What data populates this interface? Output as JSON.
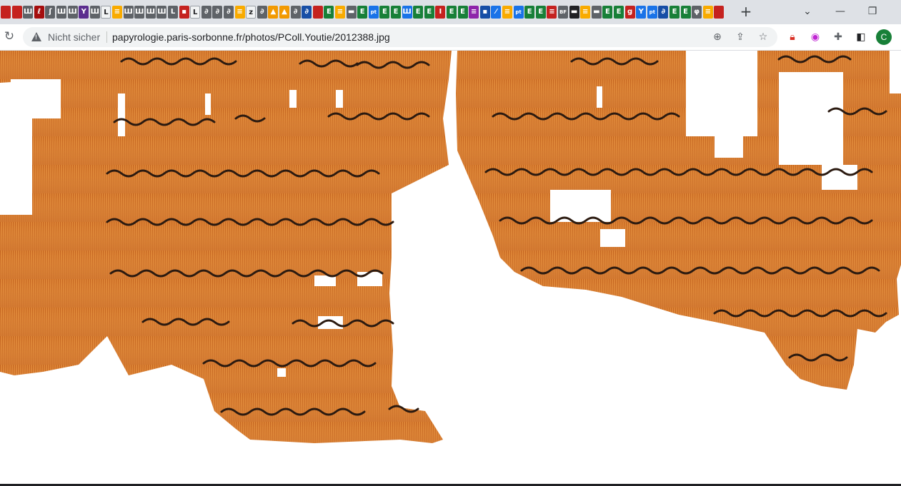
{
  "tabs": {
    "count_label": "",
    "items": [
      {
        "icon": "red-tab-icon",
        "color": "#c5221f",
        "glyph": ""
      },
      {
        "icon": "red-tab-icon",
        "color": "#c5221f",
        "glyph": ""
      },
      {
        "icon": "museum-tab-icon",
        "color": "#5f6368",
        "glyph": "Ш"
      },
      {
        "icon": "papyrus-tab-icon",
        "color": "#a50e0e",
        "glyph": "ℓ"
      },
      {
        "icon": "bookmark-tab-icon",
        "color": "#5f6368",
        "glyph": "ʃ"
      },
      {
        "icon": "museum-tab-icon",
        "color": "#5f6368",
        "glyph": "Ш"
      },
      {
        "icon": "museum-tab-icon",
        "color": "#5f6368",
        "glyph": "Ш"
      },
      {
        "icon": "purple-tab-icon",
        "color": "#5b2d8e",
        "glyph": "Y"
      },
      {
        "icon": "museum-tab-icon",
        "color": "#5f6368",
        "glyph": "Ш"
      },
      {
        "icon": "letter-l-tab-icon",
        "color": "#ffffff",
        "glyph": "L"
      },
      {
        "icon": "doc-tab-icon",
        "color": "#f9ab00",
        "glyph": "≡"
      },
      {
        "icon": "museum-tab-icon",
        "color": "#5f6368",
        "glyph": "Ш"
      },
      {
        "icon": "museum-tab-icon",
        "color": "#5f6368",
        "glyph": "Ш"
      },
      {
        "icon": "museum-tab-icon",
        "color": "#5f6368",
        "glyph": "Ш"
      },
      {
        "icon": "museum-tab-icon",
        "color": "#5f6368",
        "glyph": "Ш"
      },
      {
        "icon": "script-tab-icon",
        "color": "#5f6368",
        "glyph": "L"
      },
      {
        "icon": "red-tab-icon",
        "color": "#c5221f",
        "glyph": "▪"
      },
      {
        "icon": "letter-l-tab-icon",
        "color": "#ffffff",
        "glyph": "L"
      },
      {
        "icon": "circle-tab-icon",
        "color": "#5f6368",
        "glyph": "∂"
      },
      {
        "icon": "circle-tab-icon",
        "color": "#5f6368",
        "glyph": "∂"
      },
      {
        "icon": "circle-tab-icon",
        "color": "#5f6368",
        "glyph": "∂"
      },
      {
        "icon": "doc-tab-icon",
        "color": "#f9ab00",
        "glyph": "≡"
      },
      {
        "icon": "z-tab-icon",
        "color": "#ffffff",
        "glyph": "z"
      },
      {
        "icon": "circle-tab-icon",
        "color": "#5f6368",
        "glyph": "∂"
      },
      {
        "icon": "orange-tab-icon",
        "color": "#f29900",
        "glyph": "▲"
      },
      {
        "icon": "orange-tab-icon",
        "color": "#f29900",
        "glyph": "▲"
      },
      {
        "icon": "circle-tab-icon",
        "color": "#5f6368",
        "glyph": "∂"
      },
      {
        "icon": "blue-tab-icon",
        "color": "#174ea6",
        "glyph": "∂"
      },
      {
        "icon": "red-tab-icon",
        "color": "#c5221f",
        "glyph": ""
      },
      {
        "icon": "e-tab-icon",
        "color": "#188038",
        "glyph": "E"
      },
      {
        "icon": "doc-tab-icon",
        "color": "#f9ab00",
        "glyph": "≡"
      },
      {
        "icon": "book-tab-icon",
        "color": "#5f6368",
        "glyph": "▬"
      },
      {
        "icon": "e-tab-icon",
        "color": "#188038",
        "glyph": "E"
      },
      {
        "icon": "pt-tab-icon",
        "color": "#1a73e8",
        "glyph": "pt"
      },
      {
        "icon": "e-tab-icon",
        "color": "#188038",
        "glyph": "E"
      },
      {
        "icon": "e-tab-icon",
        "color": "#188038",
        "glyph": "E"
      },
      {
        "icon": "chart-tab-icon",
        "color": "#1a73e8",
        "glyph": "Ш"
      },
      {
        "icon": "e-tab-icon",
        "color": "#188038",
        "glyph": "E"
      },
      {
        "icon": "e-tab-icon",
        "color": "#188038",
        "glyph": "E"
      },
      {
        "icon": "script-tab-icon",
        "color": "#c5221f",
        "glyph": "I"
      },
      {
        "icon": "e-tab-icon",
        "color": "#188038",
        "glyph": "E"
      },
      {
        "icon": "e-tab-icon",
        "color": "#188038",
        "glyph": "E"
      },
      {
        "icon": "stack-tab-icon",
        "color": "#8e24aa",
        "glyph": "≡"
      },
      {
        "icon": "blue-tab-icon",
        "color": "#174ea6",
        "glyph": "▪"
      },
      {
        "icon": "feather-tab-icon",
        "color": "#1a73e8",
        "glyph": "⁄"
      },
      {
        "icon": "doc-tab-icon",
        "color": "#f9ab00",
        "glyph": "≡"
      },
      {
        "icon": "pt-tab-icon",
        "color": "#1a73e8",
        "glyph": "pt"
      },
      {
        "icon": "e-tab-icon",
        "color": "#188038",
        "glyph": "E"
      },
      {
        "icon": "e-tab-icon",
        "color": "#188038",
        "glyph": "E"
      },
      {
        "icon": "list-tab-icon",
        "color": "#c5221f",
        "glyph": "≡"
      },
      {
        "icon": "bf-tab-icon",
        "color": "#5f6368",
        "glyph": "BF"
      },
      {
        "icon": "dark-tab-icon",
        "color": "#202124",
        "glyph": "▬"
      },
      {
        "icon": "doc-tab-icon",
        "color": "#f9ab00",
        "glyph": "≡"
      },
      {
        "icon": "book-tab-icon",
        "color": "#5f6368",
        "glyph": "▬"
      },
      {
        "icon": "e-tab-icon",
        "color": "#188038",
        "glyph": "E"
      },
      {
        "icon": "e-tab-icon",
        "color": "#188038",
        "glyph": "E"
      },
      {
        "icon": "g-tab-icon",
        "color": "#c5221f",
        "glyph": "g"
      },
      {
        "icon": "y-tab-icon",
        "color": "#1a73e8",
        "glyph": "Y"
      },
      {
        "icon": "pt-tab-icon",
        "color": "#1a73e8",
        "glyph": "pt"
      },
      {
        "icon": "blue-tab-icon",
        "color": "#174ea6",
        "glyph": "∂"
      },
      {
        "icon": "e-tab-icon",
        "color": "#188038",
        "glyph": "E"
      },
      {
        "icon": "e-tab-icon",
        "color": "#188038",
        "glyph": "E"
      },
      {
        "icon": "phi-tab-icon",
        "color": "#5f6368",
        "glyph": "φ"
      },
      {
        "icon": "doc-tab-icon",
        "color": "#f9ab00",
        "glyph": "≡"
      },
      {
        "icon": "red-tab-icon",
        "color": "#c5221f",
        "glyph": ""
      }
    ]
  },
  "window": {
    "new_tab": "+",
    "tab_search": "⌄",
    "minimize": "—",
    "restore": "❐"
  },
  "toolbar": {
    "reload_icon": "reload-icon",
    "security_label": "Nicht sicher",
    "url": "papyrologie.paris-sorbonne.fr/photos/PColl.Youtie/2012388.jpg",
    "profile_initial": "C"
  },
  "colors": {
    "papyrus": "#d97a2e",
    "papyrus_dark": "#a9531c",
    "ink": "#2b1a10",
    "profile": "#188038"
  }
}
